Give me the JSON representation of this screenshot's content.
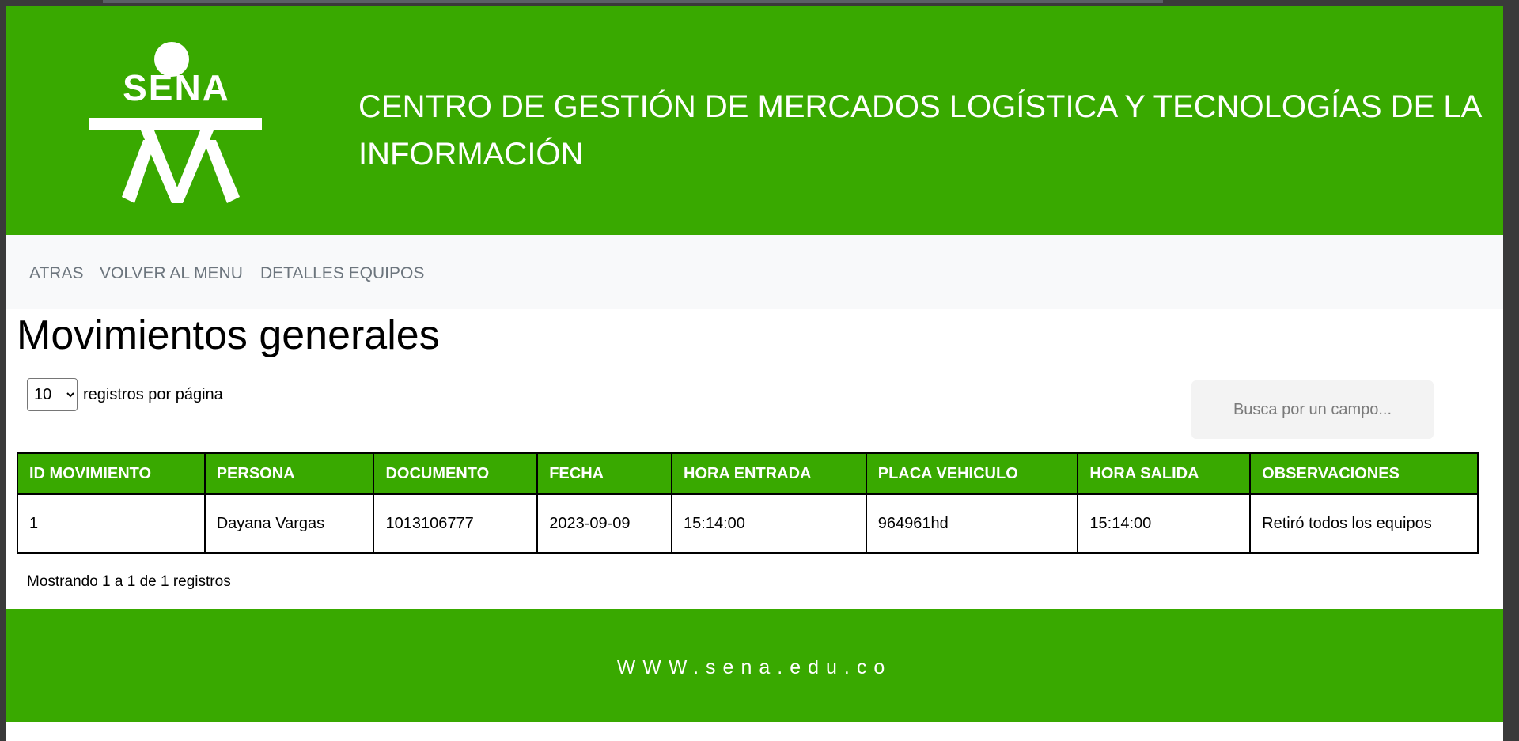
{
  "header": {
    "title": "CENTRO DE GESTIÓN DE MERCADOS LOGÍSTICA Y TECNOLOGÍAS DE LA INFORMACIÓN",
    "logo_text": "SENA"
  },
  "nav": {
    "items": [
      {
        "label": "ATRAS"
      },
      {
        "label": "VOLVER AL MENU"
      },
      {
        "label": "DETALLES EQUIPOS"
      }
    ]
  },
  "page": {
    "title": "Movimientos generales"
  },
  "controls": {
    "page_length": "10",
    "page_length_label": "registros por página",
    "search_placeholder": "Busca por un campo..."
  },
  "table": {
    "columns": [
      "ID MOVIMIENTO",
      "PERSONA",
      "DOCUMENTO",
      "FECHA",
      "HORA ENTRADA",
      "PLACA VEHICULO",
      "HORA SALIDA",
      "OBSERVACIONES"
    ],
    "rows": [
      [
        "1",
        "Dayana Vargas",
        "1013106777",
        "2023-09-09",
        "15:14:00",
        "964961hd",
        "15:14:00",
        "Retiró todos los equipos"
      ]
    ]
  },
  "info": "Mostrando 1 a 1 de 1 registros",
  "footer": {
    "text": "WWW.sena.edu.co"
  },
  "colors": {
    "brand_green": "#39a900",
    "nav_bg": "#f8f9fa",
    "nav_text": "#6c757d"
  }
}
